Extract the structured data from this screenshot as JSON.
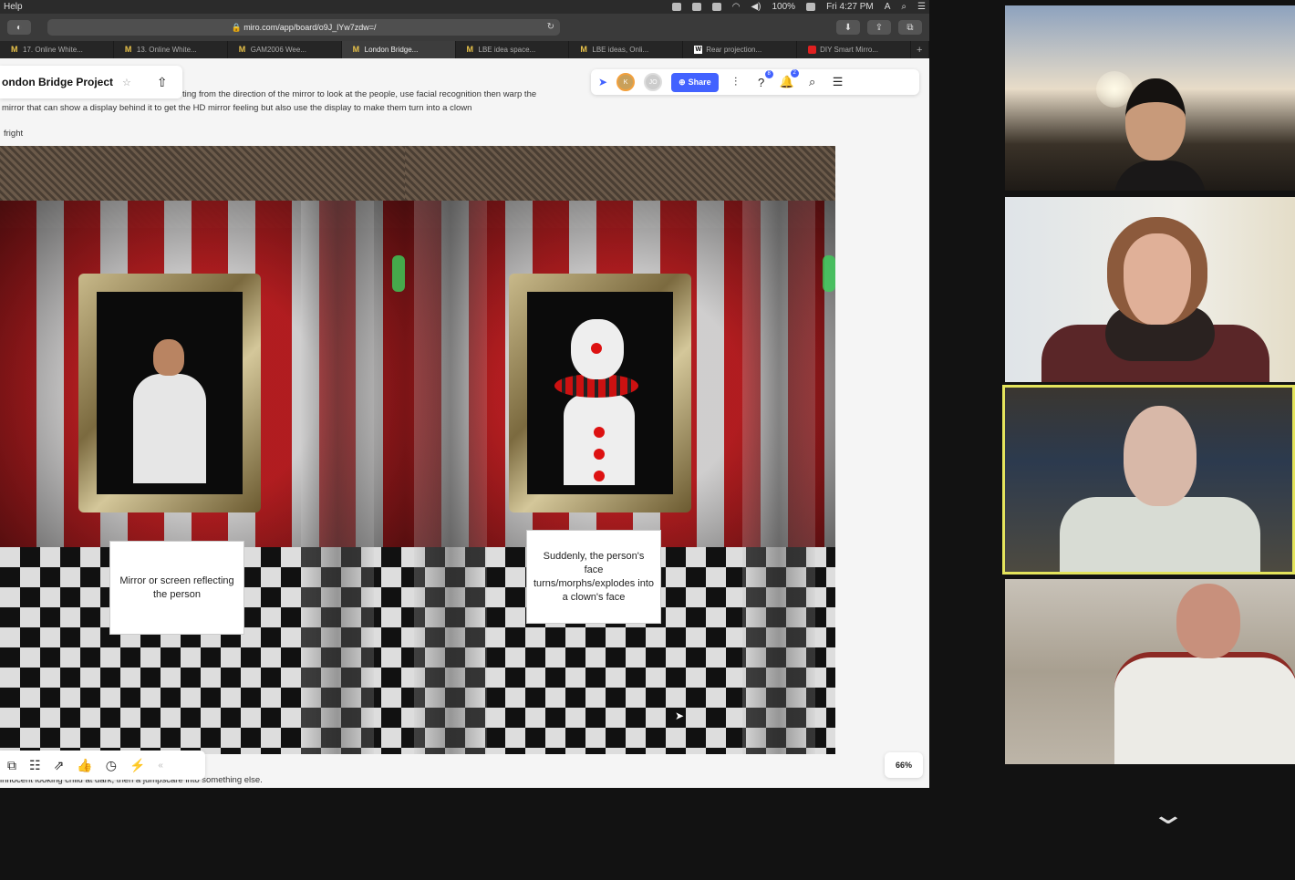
{
  "menubar": {
    "app_menu": "Help",
    "battery": "100%",
    "clock": "Fri 4:27 PM",
    "input_source": "A"
  },
  "browser": {
    "url": "miro.com/app/board/o9J_lYw7zdw=/",
    "tabs": [
      {
        "label": "17. Online White...",
        "favicon": "miro-icon",
        "active": false
      },
      {
        "label": "13. Online White...",
        "favicon": "miro-icon",
        "active": false
      },
      {
        "label": "GAM2006 Wee...",
        "favicon": "miro-icon",
        "active": false
      },
      {
        "label": "London Bridge...",
        "favicon": "miro-icon",
        "active": true
      },
      {
        "label": "LBE idea space...",
        "favicon": "miro-icon",
        "active": false
      },
      {
        "label": "LBE ideas, Onli...",
        "favicon": "miro-icon",
        "active": false
      },
      {
        "label": "Rear projection...",
        "favicon": "wikipedia-icon",
        "active": false
      },
      {
        "label": "DIY Smart Mirro...",
        "favicon": "youtube-icon",
        "active": false
      }
    ],
    "new_tab": "+"
  },
  "board": {
    "title": "ondon Bridge Project",
    "notes": {
      "line1": "ting from the direction of the mirror to look at the people, use facial recognition then warp the",
      "line2": "mirror that can show a display behind it to get the HD mirror feeling but also use the display to make them turn into a clown",
      "line3": "fright",
      "bottom": "innocent looking child at dark, then a jumpscare into something else."
    },
    "header": {
      "avatar_1": "K",
      "avatar_2": "JO",
      "share_label": "Share",
      "help_badge": "8",
      "notify_badge": "2"
    },
    "stickies": {
      "left": "Mirror or screen reflecting the person",
      "right": "Suddenly, the person's face turns/morphs/explodes into a clown's face"
    },
    "zoom": "66%"
  },
  "colors": {
    "miro_blue": "#4262ff",
    "active_speaker": "#e4e45c",
    "curtain_red": "#b81d20"
  }
}
